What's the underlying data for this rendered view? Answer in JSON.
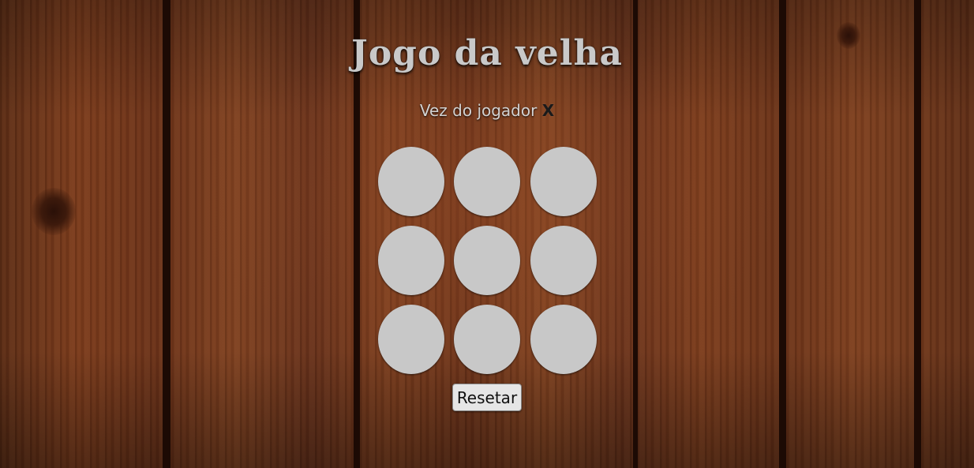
{
  "page": {
    "title": "Jogo da velha"
  },
  "status": {
    "prefix": "Vez do jogador",
    "current_player": "X"
  },
  "board": {
    "cells": [
      "",
      "",
      "",
      "",
      "",
      "",
      "",
      "",
      ""
    ]
  },
  "controls": {
    "reset_label": "Resetar"
  },
  "colors": {
    "cell_fill": "#c8c8c8",
    "title_text": "#c9c9c9",
    "background_wood": "#6b3219"
  }
}
